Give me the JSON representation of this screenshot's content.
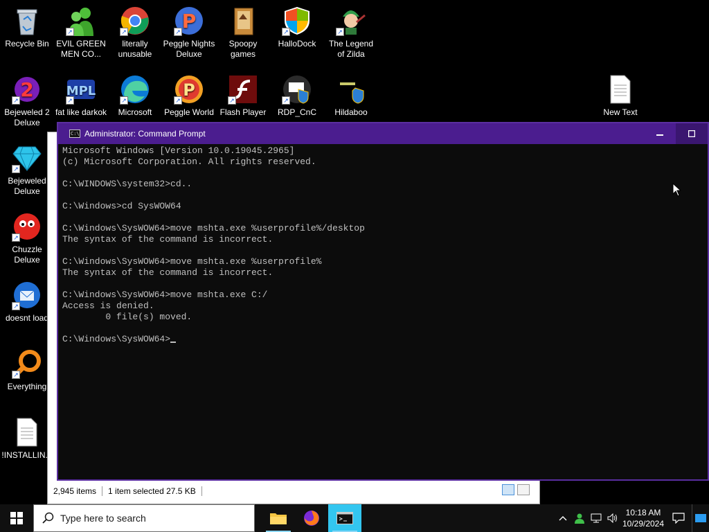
{
  "desktop": {
    "icons": [
      {
        "label": "Recycle Bin"
      },
      {
        "label": "EVIL GREEN MEN CO..."
      },
      {
        "label": "literally unusable"
      },
      {
        "label": "Peggle Nights Deluxe"
      },
      {
        "label": "Spoopy games"
      },
      {
        "label": "HalloDock"
      },
      {
        "label": "The Legend of Zilda"
      },
      {
        "label": "Bejeweled 2 Deluxe"
      },
      {
        "label": "fat like darkok"
      },
      {
        "label": "Microsoft"
      },
      {
        "label": "Peggle World"
      },
      {
        "label": "Flash Player"
      },
      {
        "label": "RDP_CnC"
      },
      {
        "label": "Hildaboo"
      },
      {
        "label": "New Text"
      },
      {
        "label": "Bejeweled Deluxe"
      },
      {
        "label": "Chuzzle Deluxe"
      },
      {
        "label": "doesnt load"
      },
      {
        "label": "Everything"
      },
      {
        "label": "!INSTALLIN..."
      }
    ]
  },
  "explorer": {
    "status_items": "2,945 items",
    "status_selected": "1 item selected  27.5 KB"
  },
  "cmd": {
    "title": "Administrator: Command Prompt",
    "lines": [
      "Microsoft Windows [Version 10.0.19045.2965]",
      "(c) Microsoft Corporation. All rights reserved.",
      "",
      "C:\\WINDOWS\\system32>cd..",
      "",
      "C:\\Windows>cd SysWOW64",
      "",
      "C:\\Windows\\SysWOW64>move mshta.exe %userprofile%/desktop",
      "The syntax of the command is incorrect.",
      "",
      "C:\\Windows\\SysWOW64>move mshta.exe %userprofile%",
      "The syntax of the command is incorrect.",
      "",
      "C:\\Windows\\SysWOW64>move mshta.exe C:/",
      "Access is denied.",
      "        0 file(s) moved.",
      "",
      "C:\\Windows\\SysWOW64>"
    ]
  },
  "taskbar": {
    "search_placeholder": "Type here to search",
    "time": "10:18 AM",
    "date": "10/29/2024"
  },
  "colors": {
    "title_bar": "#4b1d8f",
    "console_bg": "#0c0c0c",
    "console_text": "#c0c0c0",
    "active_app": "#33c6f0"
  }
}
